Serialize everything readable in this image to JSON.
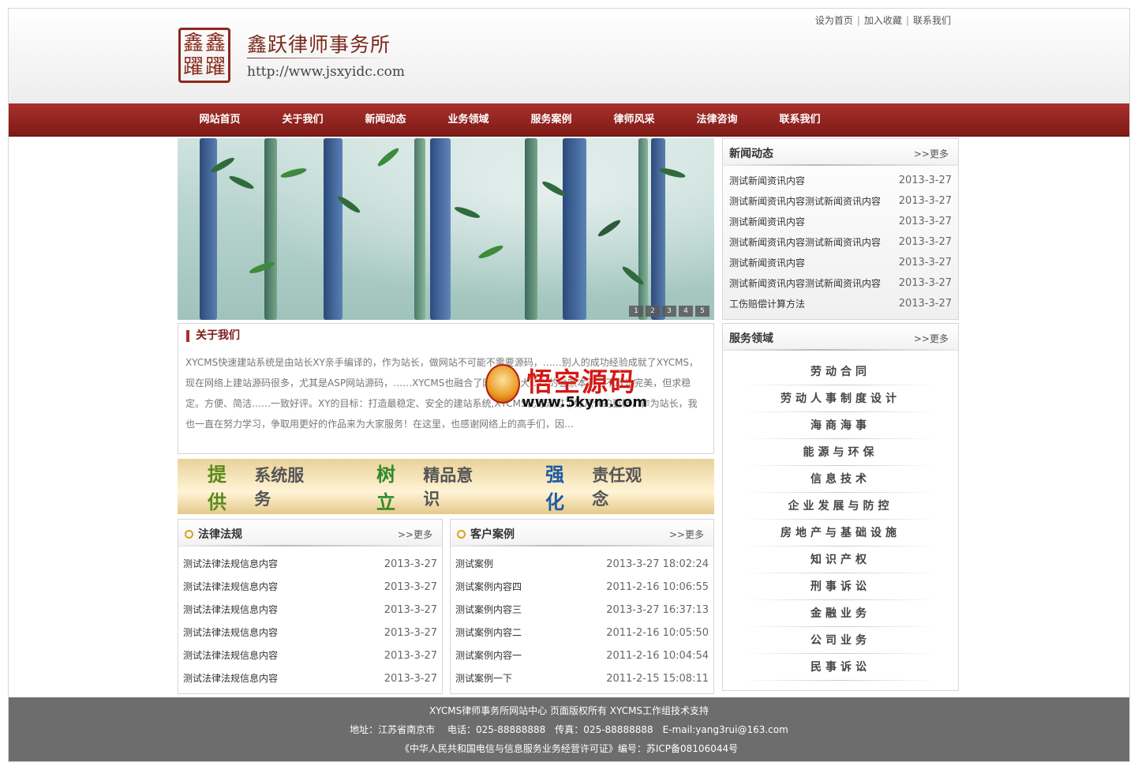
{
  "header": {
    "logo_chars": [
      "鑫",
      "鑫",
      "躍",
      "躍"
    ],
    "site_name": "鑫跃律师事务所",
    "site_url": "http://www.jsxyidc.com",
    "top_links": [
      "设为首页",
      "加入收藏",
      "联系我们"
    ]
  },
  "nav": [
    "网站首页",
    "关于我们",
    "新闻动态",
    "业务领域",
    "服务案例",
    "律师风采",
    "法律咨询",
    "联系我们"
  ],
  "banner": {
    "slides": [
      "1",
      "2",
      "3",
      "4",
      "5"
    ]
  },
  "about": {
    "title": "关于我们",
    "text": "XYCMS快速建站系统是由站长XY亲手编译的，作为站长，做网站不可能不需要源码，……别人的成功经验成就了XYCMS，现在网络上建站源码很多，尤其是ASP网站源码，……XYCMS也融合了网络上广大CXY的看家本领，不敢说完美，但求稳定。方便、简洁……一致好评。XY的目标：打造最稳定、安全的建站系统,XYCMS已经走过了好几代的更新，作为站长，我也一直在努力学习，争取用更好的作品来为大家服务！在这里，也感谢网络上的高手们，因…"
  },
  "slogan": [
    {
      "key": "提供",
      "text": "系统服务",
      "color": "#5a8a1c"
    },
    {
      "key": "树立",
      "text": "精品意识",
      "color": "#2f8a2c"
    },
    {
      "key": "强化",
      "text": "责任观念",
      "color": "#1e5aa8"
    }
  ],
  "laws": {
    "title": "法律法规",
    "more": ">>更多",
    "items": [
      {
        "t": "测试法律法规信息内容",
        "d": "2013-3-27"
      },
      {
        "t": "测试法律法规信息内容",
        "d": "2013-3-27"
      },
      {
        "t": "测试法律法规信息内容",
        "d": "2013-3-27"
      },
      {
        "t": "测试法律法规信息内容",
        "d": "2013-3-27"
      },
      {
        "t": "测试法律法规信息内容",
        "d": "2013-3-27"
      },
      {
        "t": "测试法律法规信息内容",
        "d": "2013-3-27"
      }
    ]
  },
  "cases": {
    "title": "客户案例",
    "more": ">>更多",
    "items": [
      {
        "t": "测试案例",
        "d": "2013-3-27 18:02:24"
      },
      {
        "t": "测试案例内容四",
        "d": "2011-2-16 10:06:55"
      },
      {
        "t": "测试案例内容三",
        "d": "2013-3-27 16:37:13"
      },
      {
        "t": "测试案例内容二",
        "d": "2011-2-16 10:05:50"
      },
      {
        "t": "测试案例内容一",
        "d": "2011-2-16 10:04:54"
      },
      {
        "t": "测试案例一下",
        "d": "2011-2-15 15:08:11"
      }
    ]
  },
  "news": {
    "title": "新闻动态",
    "more": ">>更多",
    "items": [
      {
        "t": "测试新闻资讯内容",
        "d": "2013-3-27"
      },
      {
        "t": "测试新闻资讯内容测试新闻资讯内容",
        "d": "2013-3-27"
      },
      {
        "t": "测试新闻资讯内容",
        "d": "2013-3-27"
      },
      {
        "t": "测试新闻资讯内容测试新闻资讯内容",
        "d": "2013-3-27"
      },
      {
        "t": "测试新闻资讯内容",
        "d": "2013-3-27"
      },
      {
        "t": "测试新闻资讯内容测试新闻资讯内容",
        "d": "2013-3-27"
      },
      {
        "t": "工伤赔偿计算方法",
        "d": "2013-3-27"
      }
    ]
  },
  "service": {
    "title": "服务领域",
    "more": ">>更多",
    "items": [
      "劳动合同",
      "劳动人事制度设计",
      "海商海事",
      "能源与环保",
      "信息技术",
      "企业发展与防控",
      "房地产与基础设施",
      "知识产权",
      "刑事诉讼",
      "金融业务",
      "公司业务",
      "民事诉讼"
    ]
  },
  "watermark": {
    "title": "悟空源码",
    "url": "www.5kym.com"
  },
  "footer": {
    "line1": "XYCMS律师事务所网站中心 页面版权所有 XYCMS工作组技术支持",
    "line2": "地址：江苏省南京市　 电话：025-88888888　传真：025-88888888　E-mail:yang3rui@163.com",
    "line3": "《中华人民共和国电信与信息服务业务经营许可证》编号：苏ICP备08106044号"
  }
}
